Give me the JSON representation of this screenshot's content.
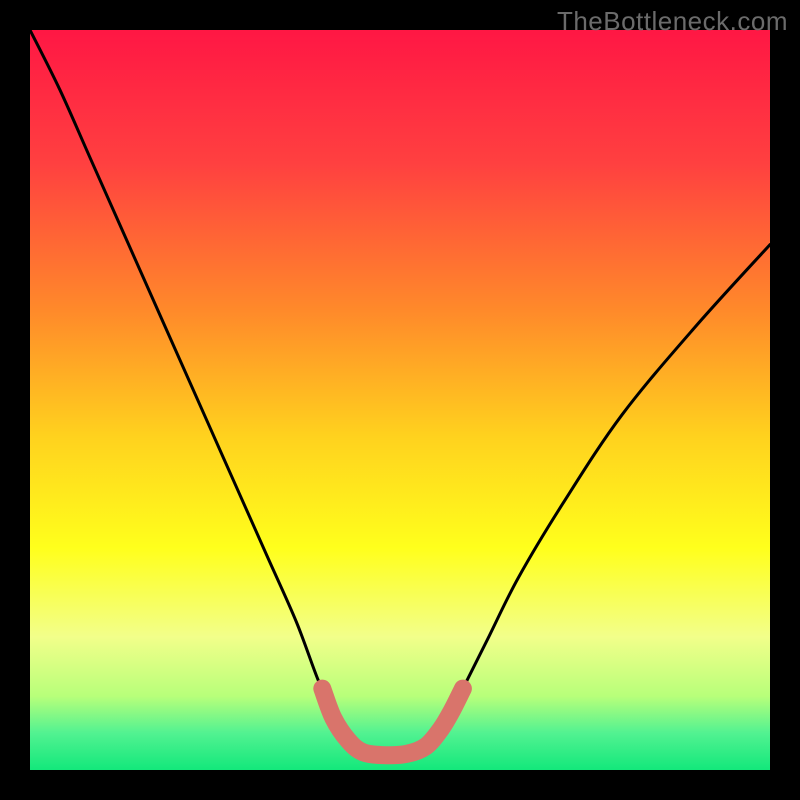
{
  "watermark": "TheBottleneck.com",
  "chart_data": {
    "type": "line",
    "title": "",
    "xlabel": "",
    "ylabel": "",
    "xlim": [
      0,
      100
    ],
    "ylim": [
      0,
      100
    ],
    "gradient_stops": [
      {
        "offset": 0,
        "color": "#ff1744"
      },
      {
        "offset": 18,
        "color": "#ff4040"
      },
      {
        "offset": 38,
        "color": "#ff8a2a"
      },
      {
        "offset": 55,
        "color": "#ffd21e"
      },
      {
        "offset": 70,
        "color": "#ffff1c"
      },
      {
        "offset": 82,
        "color": "#f2ff8a"
      },
      {
        "offset": 90,
        "color": "#b8ff7a"
      },
      {
        "offset": 95,
        "color": "#52f291"
      },
      {
        "offset": 100,
        "color": "#13e87b"
      }
    ],
    "series": [
      {
        "name": "bottleneck-curve",
        "color": "#000000",
        "x": [
          0,
          4,
          8,
          12,
          16,
          20,
          24,
          28,
          32,
          36,
          39,
          41,
          43,
          44.5,
          46,
          52,
          53.5,
          55,
          57,
          59,
          62,
          66,
          72,
          80,
          90,
          100
        ],
        "y": [
          100,
          92,
          83,
          74,
          65,
          56,
          47,
          38,
          29,
          20,
          12,
          8,
          5,
          3,
          2.2,
          2.2,
          3,
          5,
          8,
          12,
          18,
          26,
          36,
          48,
          60,
          71
        ]
      },
      {
        "name": "optimal-band",
        "color": "#d9746b",
        "thick": true,
        "x": [
          39.5,
          41,
          43,
          45,
          48,
          51,
          53.5,
          55.5,
          57,
          58.5
        ],
        "y": [
          11,
          7,
          4,
          2.4,
          2.0,
          2.2,
          3.2,
          5.5,
          8,
          11
        ]
      }
    ],
    "annotations": []
  }
}
